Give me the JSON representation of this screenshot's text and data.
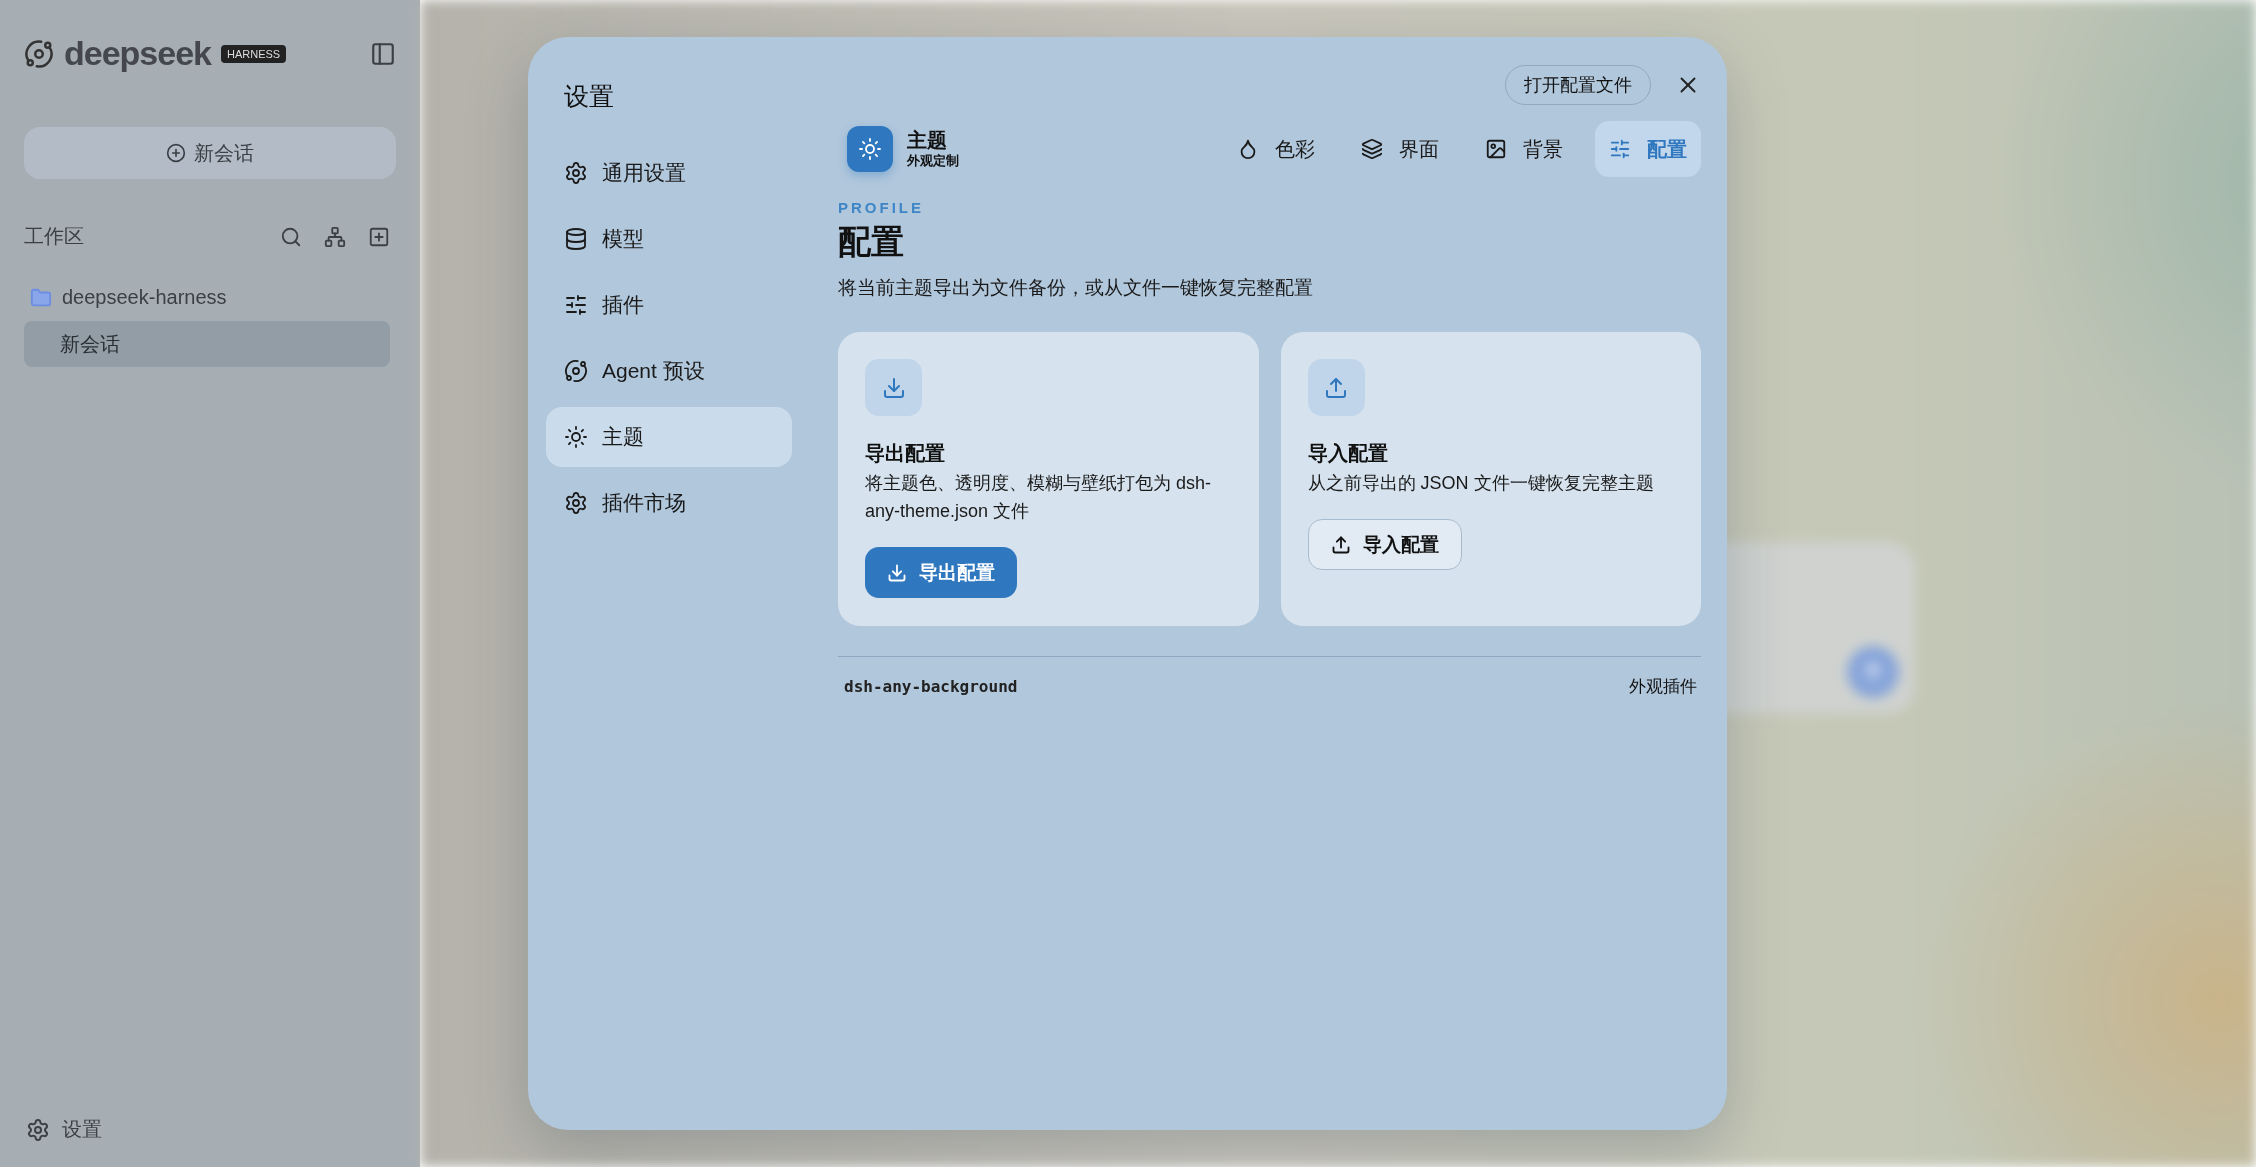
{
  "backdrop": {
    "logo": "deepseek",
    "badge": "HARNESS",
    "new_chat": "新会话",
    "workspace_label": "工作区",
    "folder": "deepseek-harness",
    "sessions": [
      {
        "label": "新会话",
        "selected": true
      }
    ],
    "settings": "设置"
  },
  "dialog": {
    "title": "设置",
    "open_file_button": "打开配置文件",
    "nav": [
      {
        "label": "通用设置",
        "selected": false
      },
      {
        "label": "模型",
        "selected": false
      },
      {
        "label": "插件",
        "selected": false
      },
      {
        "label": "Agent 预设",
        "selected": false
      },
      {
        "label": "主题",
        "selected": true
      },
      {
        "label": "插件市场",
        "selected": false
      }
    ],
    "header": {
      "title": "主题",
      "subtitle": "外观定制"
    },
    "tabs": [
      {
        "label": "色彩",
        "selected": false
      },
      {
        "label": "界面",
        "selected": false
      },
      {
        "label": "背景",
        "selected": false
      },
      {
        "label": "配置",
        "selected": true
      }
    ],
    "section": {
      "eyebrow": "PROFILE",
      "title": "配置",
      "description": "将当前主题导出为文件备份，或从文件一键恢复完整配置"
    },
    "cards": [
      {
        "kind": "export",
        "title": "导出配置",
        "description": "将主题色、透明度、模糊与壁纸打包为 dsh-any-theme.json 文件",
        "button": "导出配置"
      },
      {
        "kind": "import",
        "title": "导入配置",
        "description": "从之前导出的 JSON 文件一键恢复完整主题",
        "button": "导入配置"
      }
    ],
    "footer": {
      "plugin_id": "dsh-any-background",
      "plugin_type": "外观插件"
    }
  }
}
